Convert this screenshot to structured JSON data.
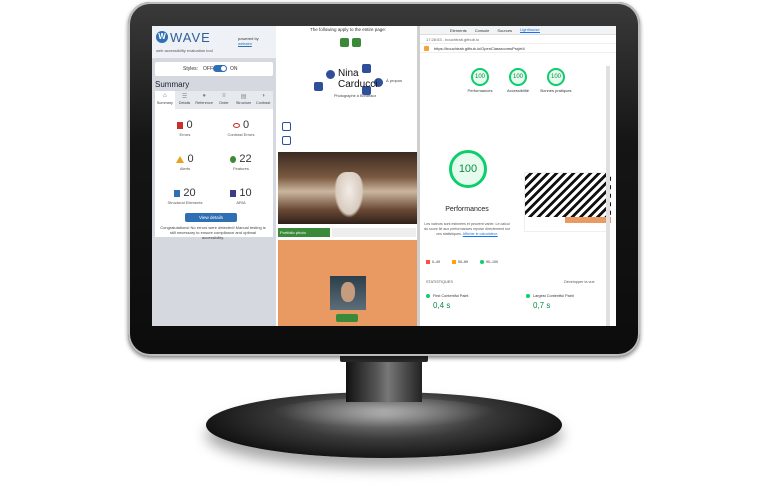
{
  "wave": {
    "logo_letter": "W",
    "title": "WAVE",
    "subtitle": "web accessibility evaluation tool",
    "powered_by": "powered by",
    "powered_link": "webaim",
    "styles_label": "Styles:",
    "styles_off": "OFF",
    "styles_on": "ON",
    "summary_title": "Summary",
    "tabs": [
      "Summary",
      "Details",
      "Reference",
      "Order",
      "Structure",
      "Contrast"
    ],
    "stats": {
      "errors": {
        "value": "0",
        "label": "Errors"
      },
      "contrast": {
        "value": "0",
        "label": "Contrast Errors"
      },
      "alerts": {
        "value": "0",
        "label": "Alerts"
      },
      "features": {
        "value": "22",
        "label": "Features"
      },
      "structural": {
        "value": "20",
        "label": "Structural Elements"
      },
      "aria": {
        "value": "10",
        "label": "ARIA"
      }
    },
    "view_button": "View details",
    "congrats": "Congratulations! No errors were detected! Manual testing is still necessary to ensure compliance and optimal accessibility."
  },
  "page": {
    "banner": "The following apply to the entire page:",
    "name_first": "Nina",
    "name_last": "Carducci",
    "tagline": "Photographe à Bordeaux",
    "apropos": "À propos",
    "photo_tag": "Portfolio photo"
  },
  "devtools": {
    "tabs": [
      "Elements",
      "Console",
      "Sources",
      "Lighthouse"
    ],
    "active_tab": "Lighthouse",
    "bar_text": "17:28:53 - bouchtrab.github.io",
    "url": "https://bouchtrab.github.io/OpenClassroomsProjet4",
    "scores": [
      {
        "value": "100",
        "label": "Performances"
      },
      {
        "value": "100",
        "label": "Accessibilité"
      },
      {
        "value": "100",
        "label": "Bonnes pratiques"
      }
    ],
    "main_score": "100",
    "main_label": "Performances",
    "desc": "Les valeurs sont estimées et peuvent varier. Le calcul du score lié aux performances repose directement sur ces statistiques.",
    "desc_link": "Afficher le calculateur.",
    "legend": [
      "0–49",
      "50–89",
      "90–100"
    ],
    "stats_header": "STATISTIQUES",
    "expand_label": "Développer la vue",
    "fcp_label": "First Contentful Paint",
    "fcp_value": "0,4 s",
    "lcp_label": "Largest Contentful Paint",
    "lcp_value": "0,7 s"
  },
  "colors": {
    "wave_blue": "#2f6fb3",
    "lighthouse_green": "#0cce6b",
    "page_orange": "#e99a62"
  }
}
